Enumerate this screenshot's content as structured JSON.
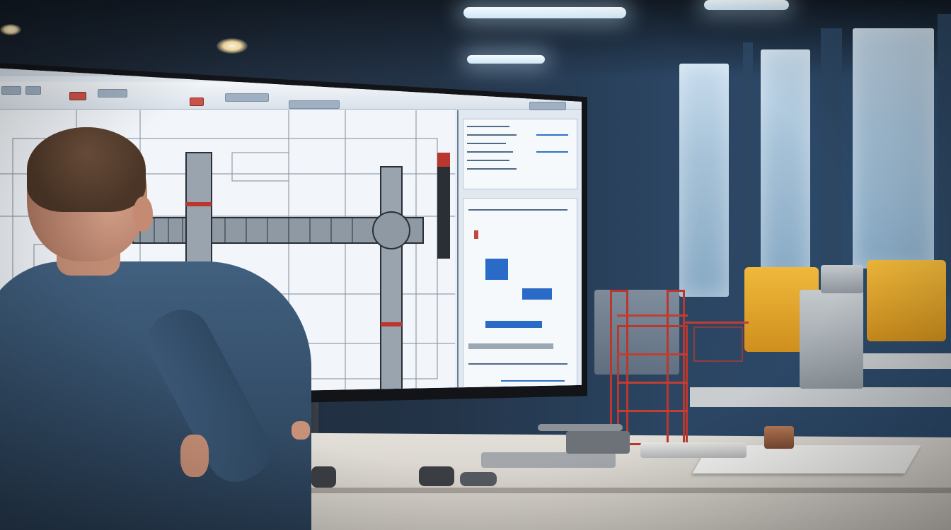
{
  "scene": {
    "description_tag": "",
    "colors": {
      "wall": "#233347",
      "window": "#a6c2d8",
      "screen": "#e7eef6",
      "shirt": "#344e69",
      "model_red": "#b9372e",
      "machine_yellow": "#f0b93b",
      "desk": "#e2ded8"
    },
    "icons": [
      "cad-drawing-icon",
      "pipe-model-icon"
    ]
  }
}
